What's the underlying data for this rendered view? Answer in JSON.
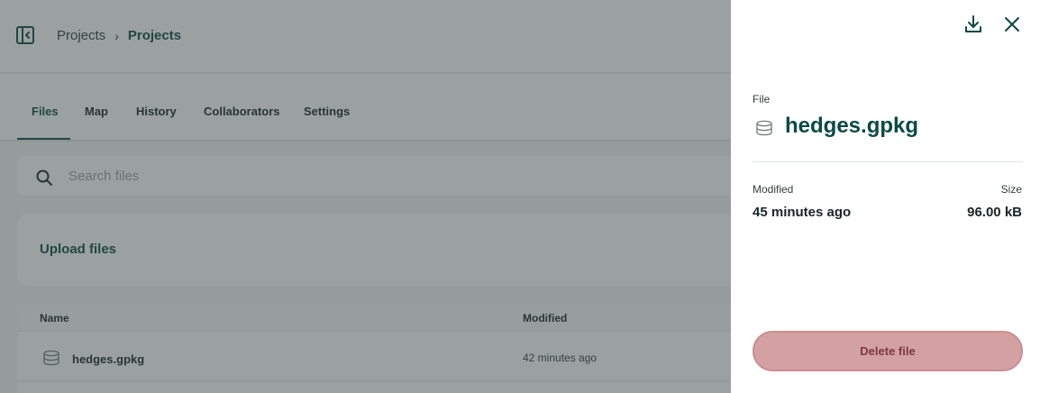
{
  "breadcrumb": {
    "items": [
      "Projects",
      "Projects"
    ],
    "separator": "›"
  },
  "tabs": [
    {
      "label": "Files",
      "active": true
    },
    {
      "label": "Map",
      "active": false
    },
    {
      "label": "History",
      "active": false
    },
    {
      "label": "Collaborators",
      "active": false
    },
    {
      "label": "Settings",
      "active": false
    }
  ],
  "search": {
    "placeholder": "Search files",
    "value": ""
  },
  "upload": {
    "label": "Upload files"
  },
  "table": {
    "columns": [
      "Name",
      "Modified"
    ],
    "rows": [
      {
        "name": "hedges.gpkg",
        "modified": "42 minutes ago",
        "icon": "database-icon"
      }
    ]
  },
  "panel": {
    "kind_label": "File",
    "filename": "hedges.gpkg",
    "file_icon": "database-icon",
    "modified_label": "Modified",
    "modified_value": "45 minutes ago",
    "size_label": "Size",
    "size_value": "96.00 kB",
    "delete_label": "Delete file",
    "actions": [
      "download-icon",
      "close-icon"
    ]
  },
  "colors": {
    "brand": "#0b4a45",
    "overlay": "#374442",
    "delete_bg": "#d4a1a3",
    "delete_text": "#7a3940"
  }
}
